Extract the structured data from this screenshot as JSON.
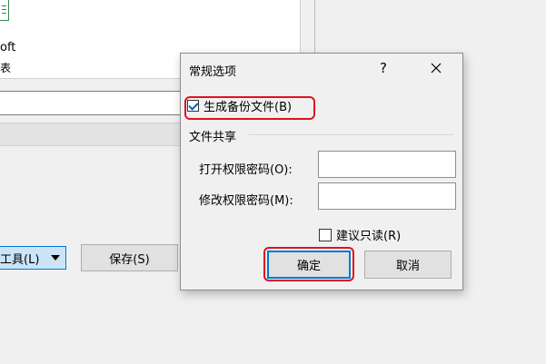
{
  "background": {
    "text_line1": "oft",
    "text_line2": "表",
    "tools_label": "工具(L)",
    "save_label": "保存(S)"
  },
  "dialog": {
    "title": "常规选项",
    "help_label": "?",
    "backup_checkbox": {
      "label": "生成备份文件(B)",
      "checked": true
    },
    "group_label": "文件共享",
    "open_password_label": "打开权限密码(O):",
    "open_password_value": "",
    "modify_password_label": "修改权限密码(M):",
    "modify_password_value": "",
    "readonly_checkbox": {
      "label": "建议只读(R)",
      "checked": false
    },
    "ok_label": "确定",
    "cancel_label": "取消"
  },
  "colors": {
    "highlight": "#e01020",
    "focus": "#0078d7",
    "check": "#0060c0"
  }
}
